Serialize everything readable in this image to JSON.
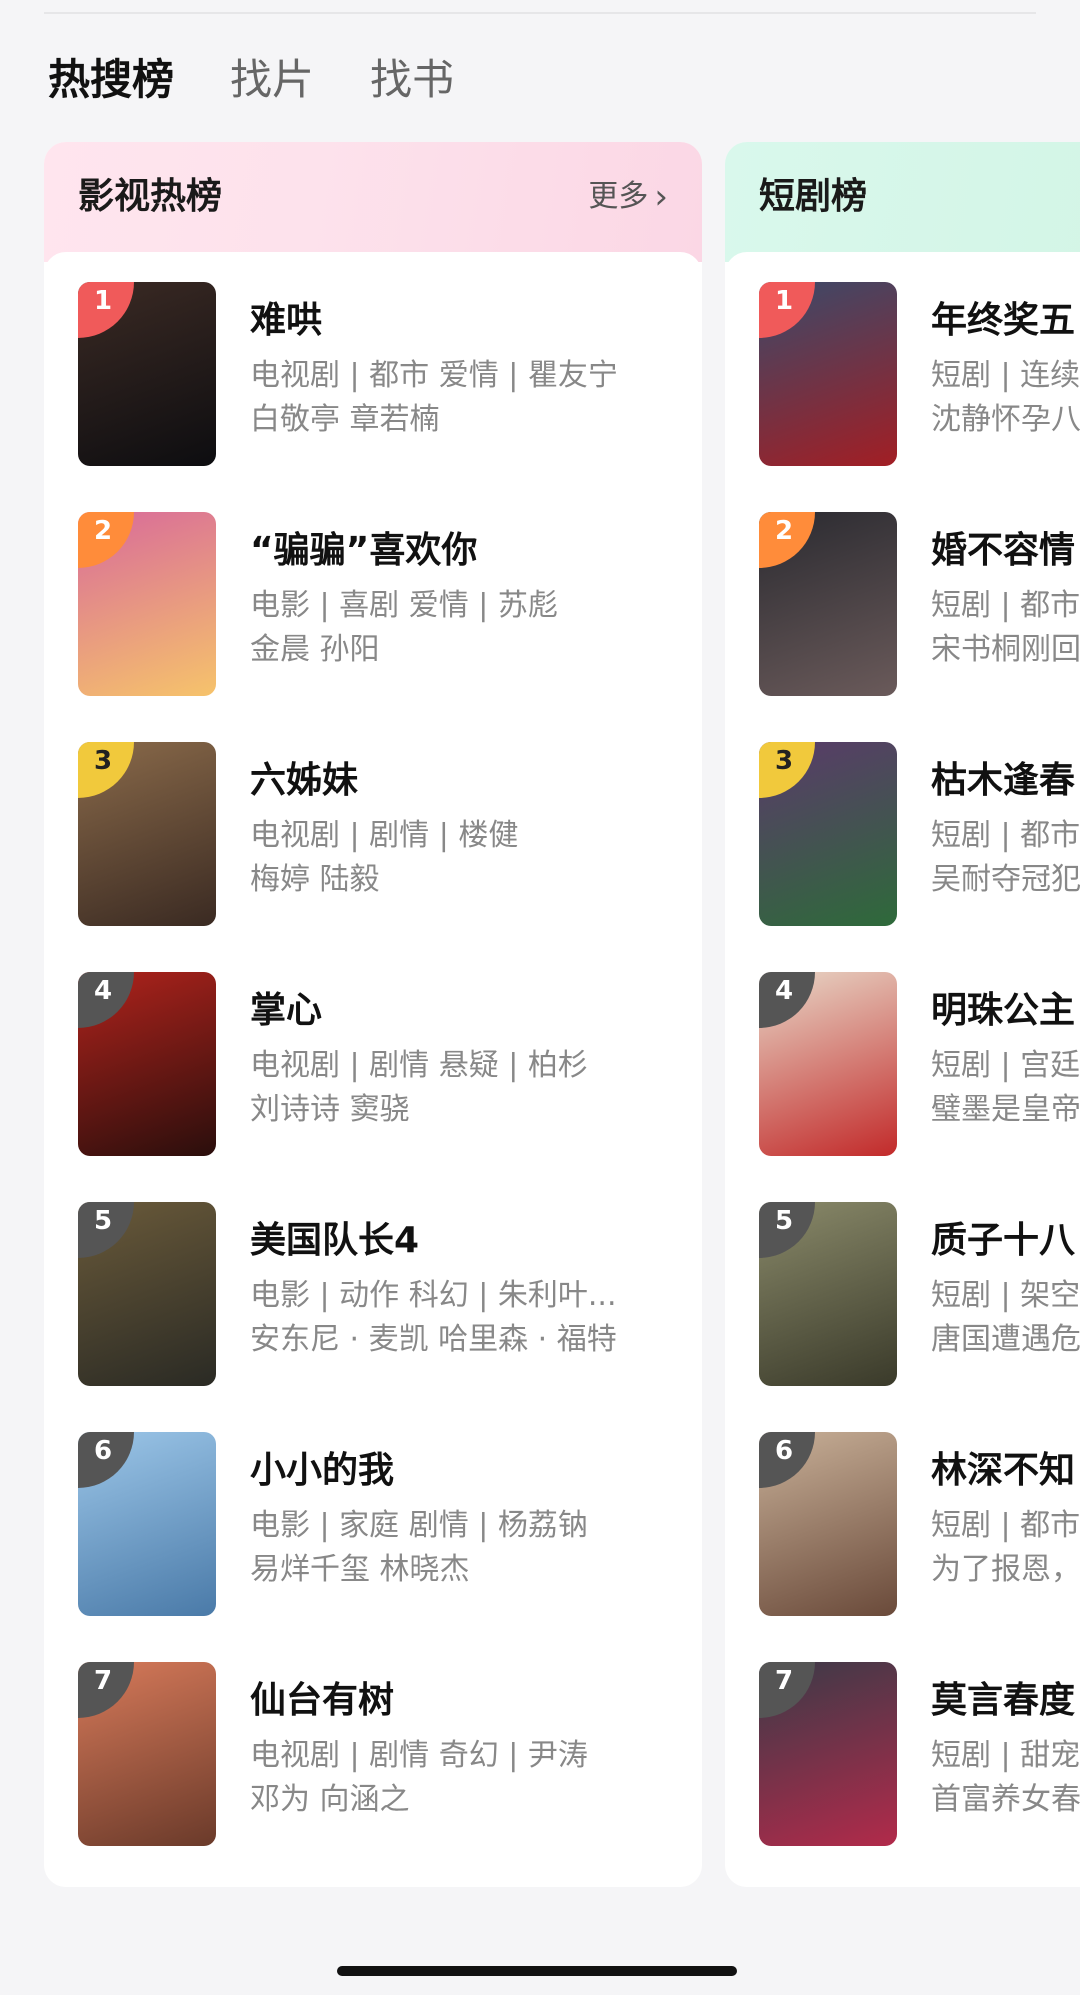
{
  "tabs": [
    {
      "label": "热搜榜",
      "active": true
    },
    {
      "label": "找片",
      "active": false
    },
    {
      "label": "找书",
      "active": false
    }
  ],
  "film_card": {
    "title": "影视热榜",
    "more_label": "更多",
    "items": [
      {
        "rank": "1",
        "name": "难哄",
        "meta": "电视剧 | 都市 爱情 | 瞿友宁",
        "cast": "白敬亭 章若楠",
        "poster_colors": [
          "#3b2a24",
          "#0d0d10"
        ]
      },
      {
        "rank": "2",
        "name": "“骗骗”喜欢你",
        "meta": "电影 | 喜剧 爱情 | 苏彪",
        "cast": "金晨 孙阳",
        "poster_colors": [
          "#d86a9a",
          "#f6c36b"
        ]
      },
      {
        "rank": "3",
        "name": "六姊妹",
        "meta": "电视剧 | 剧情 | 楼健",
        "cast": "梅婷 陆毅",
        "poster_colors": [
          "#8a6a4a",
          "#3a2a22"
        ]
      },
      {
        "rank": "4",
        "name": "掌心",
        "meta": "电视剧 | 剧情 悬疑 | 柏杉",
        "cast": "刘诗诗 窦骁",
        "poster_colors": [
          "#b0231c",
          "#2a0e0c"
        ]
      },
      {
        "rank": "5",
        "name": "美国队长4",
        "meta": "电影 | 动作 科幻 | 朱利叶...",
        "cast": "安东尼 · 麦凯 哈里森 · 福特",
        "poster_colors": [
          "#6a5a3a",
          "#2a2a24"
        ]
      },
      {
        "rank": "6",
        "name": "小小的我",
        "meta": "电影 | 家庭 剧情 | 杨荔钠",
        "cast": "易烊千玺 林晓杰",
        "poster_colors": [
          "#9cc6e8",
          "#4a7aa8"
        ]
      },
      {
        "rank": "7",
        "name": "仙台有树",
        "meta": "电视剧 | 剧情 奇幻 | 尹涛",
        "cast": "邓为 向涵之",
        "poster_colors": [
          "#d77a5a",
          "#6a3a2a"
        ]
      }
    ]
  },
  "short_card": {
    "title": "短剧榜",
    "items": [
      {
        "rank": "1",
        "name": "年终奖五",
        "meta": "短剧 | 连续",
        "cast": "沈静怀孕八",
        "poster_colors": [
          "#3a4a6a",
          "#a21e24"
        ]
      },
      {
        "rank": "2",
        "name": "婚不容情",
        "meta": "短剧 | 都市",
        "cast": "宋书桐刚回",
        "poster_colors": [
          "#2a2a30",
          "#6a5a5a"
        ]
      },
      {
        "rank": "3",
        "name": "枯木逢春",
        "meta": "短剧 | 都市",
        "cast": "吴耐夺冠犯",
        "poster_colors": [
          "#5a3a6a",
          "#2e6a3a"
        ]
      },
      {
        "rank": "4",
        "name": "明珠公主",
        "meta": "短剧 | 宫廷",
        "cast": "璧墨是皇帝",
        "poster_colors": [
          "#e8d8c8",
          "#c22a2a"
        ]
      },
      {
        "rank": "5",
        "name": "质子十八",
        "meta": "短剧 | 架空",
        "cast": "唐国遭遇危",
        "poster_colors": [
          "#8a8a6a",
          "#3a3a2a"
        ]
      },
      {
        "rank": "6",
        "name": "林深不知",
        "meta": "短剧 | 都市",
        "cast": "为了报恩，",
        "poster_colors": [
          "#c8b098",
          "#6a4a3a"
        ]
      },
      {
        "rank": "7",
        "name": "莫言春度",
        "meta": "短剧 | 甜宠",
        "cast": "首富养女春",
        "poster_colors": [
          "#3a3a48",
          "#b22a4a"
        ]
      }
    ]
  }
}
